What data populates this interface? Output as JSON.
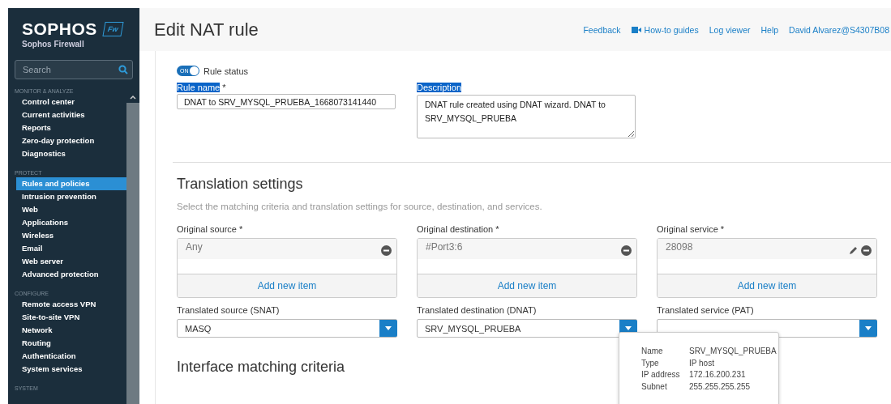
{
  "brand": {
    "logo": "SOPHOS",
    "badge": "Fw",
    "product": "Sophos Firewall"
  },
  "search": {
    "placeholder": "Search"
  },
  "sidebar": {
    "sections": [
      {
        "heading": "MONITOR & ANALYZE",
        "items": [
          {
            "label": "Control center",
            "selected": false
          },
          {
            "label": "Current activities",
            "selected": false
          },
          {
            "label": "Reports",
            "selected": false
          },
          {
            "label": "Zero-day protection",
            "selected": false
          },
          {
            "label": "Diagnostics",
            "selected": false
          }
        ]
      },
      {
        "heading": "PROTECT",
        "items": [
          {
            "label": "Rules and policies",
            "selected": true
          },
          {
            "label": "Intrusion prevention",
            "selected": false
          },
          {
            "label": "Web",
            "selected": false
          },
          {
            "label": "Applications",
            "selected": false
          },
          {
            "label": "Wireless",
            "selected": false
          },
          {
            "label": "Email",
            "selected": false
          },
          {
            "label": "Web server",
            "selected": false
          },
          {
            "label": "Advanced protection",
            "selected": false
          }
        ]
      },
      {
        "heading": "CONFIGURE",
        "items": [
          {
            "label": "Remote access VPN",
            "selected": false
          },
          {
            "label": "Site-to-site VPN",
            "selected": false
          },
          {
            "label": "Network",
            "selected": false
          },
          {
            "label": "Routing",
            "selected": false
          },
          {
            "label": "Authentication",
            "selected": false
          },
          {
            "label": "System services",
            "selected": false
          }
        ]
      },
      {
        "heading": "SYSTEM"
      }
    ]
  },
  "header": {
    "title": "Edit NAT rule",
    "links": [
      {
        "label": "Feedback",
        "kind": "link"
      },
      {
        "label": "How-to guides",
        "kind": "video"
      },
      {
        "label": "Log viewer",
        "kind": "link"
      },
      {
        "label": "Help",
        "kind": "link"
      },
      {
        "label": "David Alvarez@S4307B08",
        "kind": "link"
      }
    ]
  },
  "rule_status": {
    "toggle": "ON",
    "on": true,
    "label": "Rule status"
  },
  "rule_name": {
    "label": "Rule name",
    "required": "*",
    "value": "DNAT to SRV_MYSQL_PRUEBA_1668073141440"
  },
  "description": {
    "label": "Description",
    "value": "DNAT rule created using DNAT wizard. DNAT to SRV_MYSQL_PRUEBA"
  },
  "translation": {
    "title": "Translation settings",
    "subtitle": "Select the matching criteria and translation settings for source, destination, and services.",
    "originals": [
      {
        "label": "Original source *",
        "value": "Any",
        "editable": false,
        "add": "Add new item"
      },
      {
        "label": "Original destination *",
        "value": "#Port3:6",
        "editable": false,
        "add": "Add new item"
      },
      {
        "label": "Original service *",
        "value": "28098",
        "editable": true,
        "add": "Add new item"
      }
    ],
    "translated": [
      {
        "label": "Translated source (SNAT)",
        "value": "MASQ"
      },
      {
        "label": "Translated destination (DNAT)",
        "value": "SRV_MYSQL_PRUEBA"
      },
      {
        "label": "Translated service (PAT)"
      }
    ]
  },
  "tooltip": [
    {
      "key": "Name",
      "value": "SRV_MYSQL_PRUEBA"
    },
    {
      "key": "Type",
      "value": "IP host"
    },
    {
      "key": "IP address",
      "value": "172.16.200.231"
    },
    {
      "key": "Subnet",
      "value": "255.255.255.255"
    }
  ],
  "interface": {
    "title": "Interface matching criteria"
  }
}
